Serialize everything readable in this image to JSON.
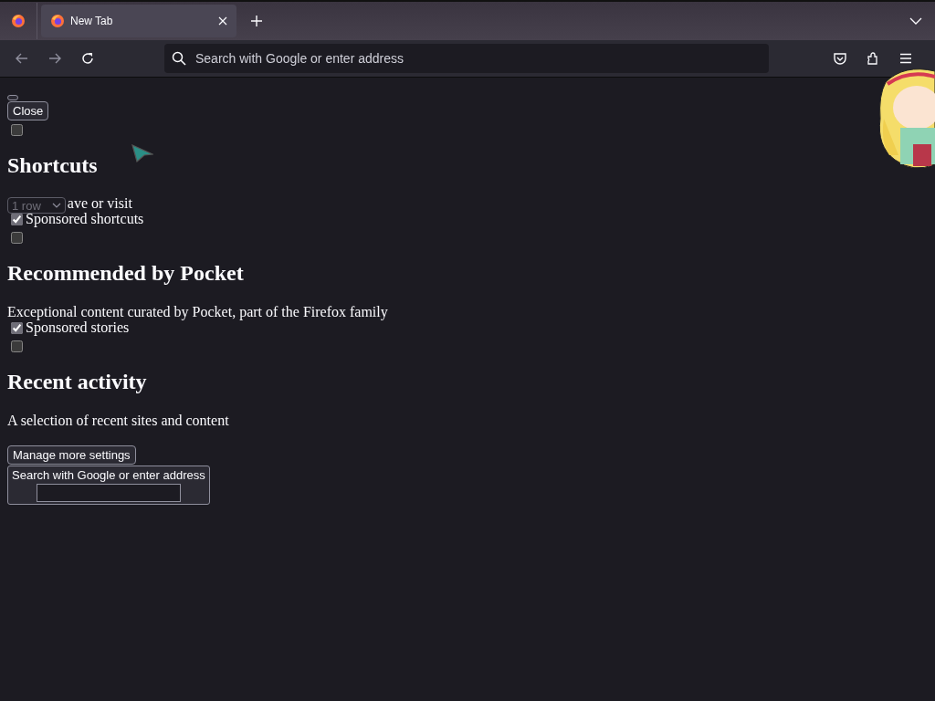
{
  "tabs": [
    {
      "title": "New Tab",
      "selected": true
    }
  ],
  "address_bar": {
    "placeholder": "Search with Google or enter address"
  },
  "page": [
    {
      "kind": "tiny_button"
    },
    {
      "kind": "button",
      "label": "Close"
    },
    {
      "kind": "checkbox",
      "checked": false
    },
    {
      "kind": "heading",
      "text": "Shortcuts"
    },
    {
      "kind": "select_line",
      "value": "1 row",
      "text": "ave or visit"
    },
    {
      "kind": "checkbox",
      "checked": true,
      "label": "Sponsored shortcuts"
    },
    {
      "kind": "checkbox",
      "checked": false
    },
    {
      "kind": "heading",
      "text": "Recommended by Pocket"
    },
    {
      "kind": "paragraph",
      "text": "Exceptional content curated by Pocket, part of the Firefox family"
    },
    {
      "kind": "checkbox",
      "checked": true,
      "label": "Sponsored stories"
    },
    {
      "kind": "checkbox",
      "checked": false
    },
    {
      "kind": "heading",
      "text": "Recent activity"
    },
    {
      "kind": "paragraph",
      "text": "A selection of recent sites and content"
    },
    {
      "kind": "button",
      "label": "Manage more settings"
    },
    {
      "kind": "search_box",
      "label": "Search with Google or enter address"
    }
  ]
}
